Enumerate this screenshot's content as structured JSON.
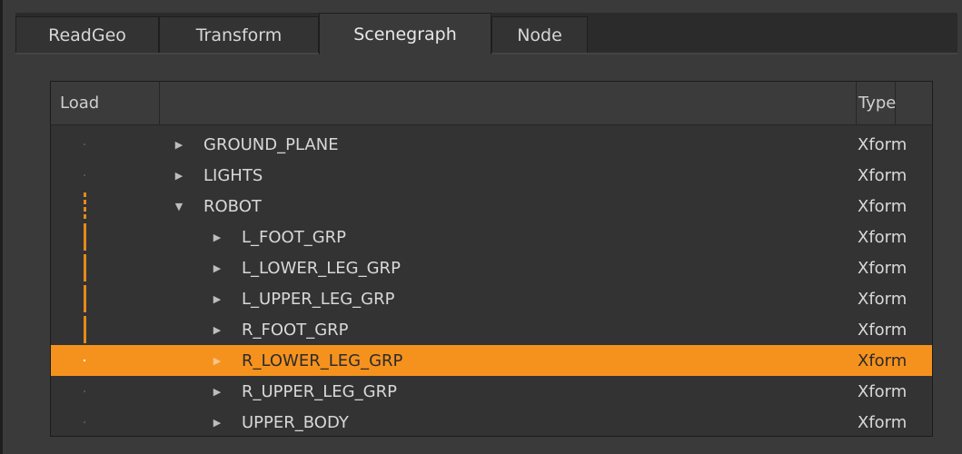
{
  "tabs": [
    {
      "label": "ReadGeo",
      "active": false
    },
    {
      "label": "Transform",
      "active": false
    },
    {
      "label": "Scenegraph",
      "active": true
    },
    {
      "label": "Node",
      "active": false
    }
  ],
  "columns": {
    "load": "Load",
    "name": "",
    "type": "Type"
  },
  "rows": [
    {
      "name": "GROUND_PLANE",
      "type": "Xform",
      "depth": 0,
      "expanded": false
    },
    {
      "name": "LIGHTS",
      "type": "Xform",
      "depth": 0,
      "expanded": false
    },
    {
      "name": "ROBOT",
      "type": "Xform",
      "depth": 0,
      "expanded": true
    },
    {
      "name": "L_FOOT_GRP",
      "type": "Xform",
      "depth": 1,
      "expanded": false
    },
    {
      "name": "L_LOWER_LEG_GRP",
      "type": "Xform",
      "depth": 1,
      "expanded": false
    },
    {
      "name": "L_UPPER_LEG_GRP",
      "type": "Xform",
      "depth": 1,
      "expanded": false
    },
    {
      "name": "R_FOOT_GRP",
      "type": "Xform",
      "depth": 1,
      "expanded": false
    },
    {
      "name": "R_LOWER_LEG_GRP",
      "type": "Xform",
      "depth": 1,
      "expanded": false,
      "selected": true
    },
    {
      "name": "R_UPPER_LEG_GRP",
      "type": "Xform",
      "depth": 1,
      "expanded": false
    },
    {
      "name": "UPPER_BODY",
      "type": "Xform",
      "depth": 1,
      "expanded": false
    }
  ],
  "colors": {
    "accent": "#f5921e",
    "load_bar": "#e68a18"
  }
}
